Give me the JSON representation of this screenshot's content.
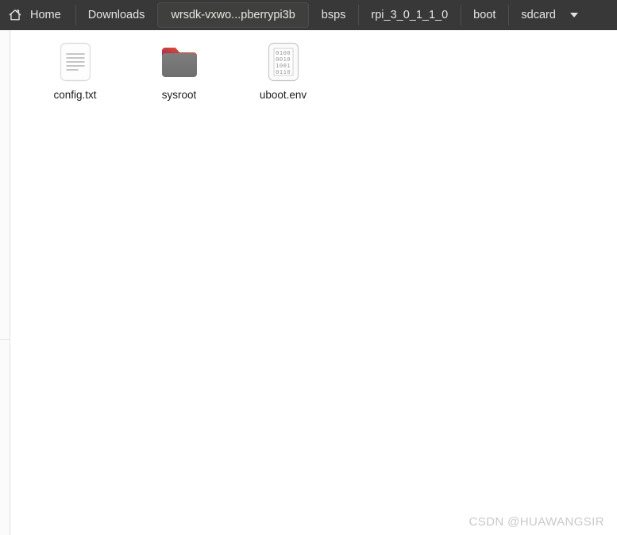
{
  "window": {
    "title": "sdcard",
    "background": "#ffffff"
  },
  "pathbar": {
    "background": "#383838",
    "text_color": "#e8e6e3",
    "active_background": "#3f3f3d",
    "home_icon": "home-icon",
    "dropdown_icon": "chevron-down-icon",
    "crumbs": [
      {
        "label": "Home",
        "icon": "home-icon",
        "state": "normal"
      },
      {
        "label": "Downloads",
        "icon": "",
        "state": "normal"
      },
      {
        "label": "wrsdk-vxwo...pberrypi3b",
        "icon": "",
        "state": "raised"
      },
      {
        "label": "bsps",
        "icon": "",
        "state": "normal"
      },
      {
        "label": "rpi_3_0_1_1_0",
        "icon": "",
        "state": "normal"
      },
      {
        "label": "boot",
        "icon": "",
        "state": "normal"
      },
      {
        "label": "sdcard",
        "icon": "chevron-down-icon",
        "state": "current"
      }
    ]
  },
  "files": {
    "items": [
      {
        "name": "config.txt",
        "kind": "text-document",
        "icon": "text-file-icon",
        "lines": 5
      },
      {
        "name": "sysroot",
        "kind": "folder",
        "icon": "folder-icon",
        "colors": {
          "tab_start": "#9b1d5a",
          "tab_end": "#ef6a24",
          "body": "#787878"
        }
      },
      {
        "name": "uboot.env",
        "kind": "binary-file",
        "icon": "binary-file-icon",
        "binary_rows": [
          "0100",
          "0010",
          "1001",
          "0110"
        ]
      }
    ]
  },
  "watermark": {
    "text": "CSDN @HUAWANGSIR",
    "color": "#c9c9c9"
  }
}
